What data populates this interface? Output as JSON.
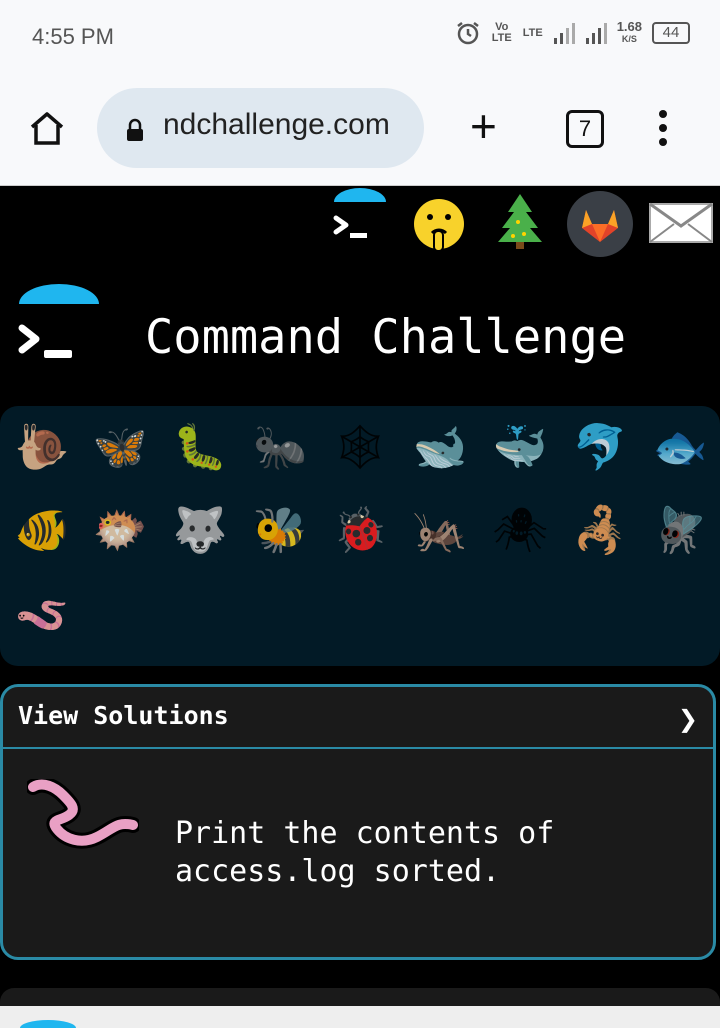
{
  "status_bar": {
    "time": "4:55 PM",
    "volte": "Vo LTE",
    "lte": "LTE",
    "speed_value": "1.68",
    "speed_unit": "K/S",
    "battery": "44"
  },
  "browser": {
    "url": "ndchallenge.com",
    "tab_count": "7"
  },
  "top_icons": [
    "terminal-icon",
    "shushing-face-icon",
    "christmas-tree-icon",
    "gitlab-icon",
    "envelope-icon"
  ],
  "site": {
    "title": "Command Challenge"
  },
  "animals": [
    {
      "name": "snail-icon",
      "glyph": "🐌"
    },
    {
      "name": "butterfly-icon",
      "glyph": "🦋"
    },
    {
      "name": "caterpillar-icon",
      "glyph": "🐛"
    },
    {
      "name": "ant-icon",
      "glyph": "🐜"
    },
    {
      "name": "spider-web-icon",
      "glyph": "🕸"
    },
    {
      "name": "whale-icon",
      "glyph": "🐋"
    },
    {
      "name": "spouting-whale-icon",
      "glyph": "🐳"
    },
    {
      "name": "dolphin-icon",
      "glyph": "🐬"
    },
    {
      "name": "fish-icon",
      "glyph": "🐟"
    },
    {
      "name": "tropical-fish-icon",
      "glyph": "🐠"
    },
    {
      "name": "blowfish-icon",
      "glyph": "🐡"
    },
    {
      "name": "wolf-icon",
      "glyph": "🐺"
    },
    {
      "name": "bee-icon",
      "glyph": "🐝"
    },
    {
      "name": "ladybug-icon",
      "glyph": "🐞"
    },
    {
      "name": "cricket-icon",
      "glyph": "🦗"
    },
    {
      "name": "spider-icon",
      "glyph": "🕷"
    },
    {
      "name": "scorpion-icon",
      "glyph": "🦂"
    },
    {
      "name": "fly-icon",
      "glyph": "🪰"
    },
    {
      "name": "worm-icon",
      "glyph": "🪱"
    }
  ],
  "solutions": {
    "label": "View Solutions",
    "chevron": "❯",
    "task_line1": "Print the contents of",
    "task_line2": "access.log sorted."
  },
  "colors": {
    "accent": "#2a8aa5",
    "cap_blue": "#1fb6ef",
    "panel": "#021a26"
  }
}
